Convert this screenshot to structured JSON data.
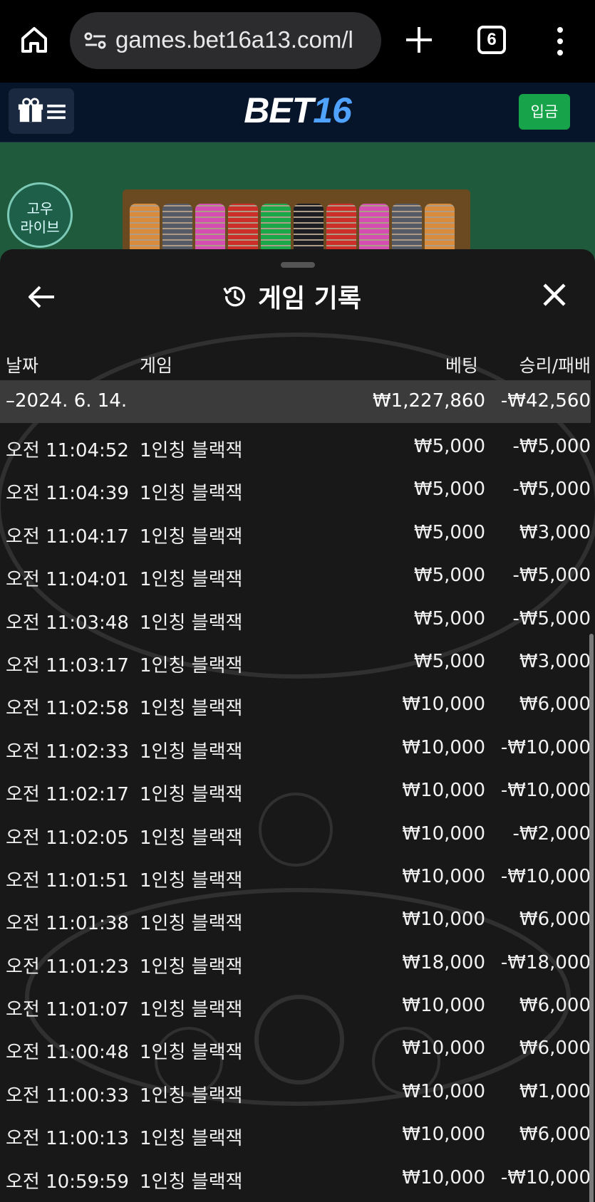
{
  "browser": {
    "url": "games.bet16a13.com/l",
    "tab_count": "6",
    "icons": [
      "home-icon",
      "site-settings-icon",
      "plus-icon",
      "tabs-icon",
      "more-vert-icon"
    ]
  },
  "header": {
    "logo_part1": "BET",
    "logo_part2": "16",
    "deposit_label": "입금",
    "colors": {
      "bg": "#07152b",
      "deposit": "#16a34a",
      "logo_accent": "#4fa3ff"
    }
  },
  "game": {
    "live_badge_line1": "고우",
    "live_badge_line2": "라이브",
    "chip_colors": [
      "#d98c3c",
      "#555b66",
      "#d44fb1",
      "#cc2f2a",
      "#1aa84a",
      "#1d1d24",
      "#cc2f2a",
      "#d44fb1",
      "#555b66",
      "#d98c3c"
    ]
  },
  "sheet": {
    "title": "게임 기록",
    "columns": {
      "date": "날짜",
      "game": "게임",
      "bet": "베팅",
      "result": "승리/패배"
    },
    "summary": {
      "date": "–2024. 6. 14.",
      "bet": "₩1,227,860",
      "result": "-₩42,560"
    },
    "rows": [
      {
        "time": "오전 11:04:52",
        "game": "1인칭 블랙잭",
        "bet": "₩5,000",
        "result": "-₩5,000"
      },
      {
        "time": "오전 11:04:39",
        "game": "1인칭 블랙잭",
        "bet": "₩5,000",
        "result": "-₩5,000"
      },
      {
        "time": "오전 11:04:17",
        "game": "1인칭 블랙잭",
        "bet": "₩5,000",
        "result": "₩3,000"
      },
      {
        "time": "오전 11:04:01",
        "game": "1인칭 블랙잭",
        "bet": "₩5,000",
        "result": "-₩5,000"
      },
      {
        "time": "오전 11:03:48",
        "game": "1인칭 블랙잭",
        "bet": "₩5,000",
        "result": "-₩5,000"
      },
      {
        "time": "오전 11:03:17",
        "game": "1인칭 블랙잭",
        "bet": "₩5,000",
        "result": "₩3,000"
      },
      {
        "time": "오전 11:02:58",
        "game": "1인칭 블랙잭",
        "bet": "₩10,000",
        "result": "₩6,000"
      },
      {
        "time": "오전 11:02:33",
        "game": "1인칭 블랙잭",
        "bet": "₩10,000",
        "result": "-₩10,000"
      },
      {
        "time": "오전 11:02:17",
        "game": "1인칭 블랙잭",
        "bet": "₩10,000",
        "result": "-₩10,000"
      },
      {
        "time": "오전 11:02:05",
        "game": "1인칭 블랙잭",
        "bet": "₩10,000",
        "result": "-₩2,000"
      },
      {
        "time": "오전 11:01:51",
        "game": "1인칭 블랙잭",
        "bet": "₩10,000",
        "result": "-₩10,000"
      },
      {
        "time": "오전 11:01:38",
        "game": "1인칭 블랙잭",
        "bet": "₩10,000",
        "result": "₩6,000"
      },
      {
        "time": "오전 11:01:23",
        "game": "1인칭 블랙잭",
        "bet": "₩18,000",
        "result": "-₩18,000"
      },
      {
        "time": "오전 11:01:07",
        "game": "1인칭 블랙잭",
        "bet": "₩10,000",
        "result": "₩6,000"
      },
      {
        "time": "오전 11:00:48",
        "game": "1인칭 블랙잭",
        "bet": "₩10,000",
        "result": "₩6,000"
      },
      {
        "time": "오전 11:00:33",
        "game": "1인칭 블랙잭",
        "bet": "₩10,000",
        "result": "₩1,000"
      },
      {
        "time": "오전 11:00:13",
        "game": "1인칭 블랙잭",
        "bet": "₩10,000",
        "result": "₩6,000"
      },
      {
        "time": "오전 10:59:59",
        "game": "1인칭 블랙잭",
        "bet": "₩10,000",
        "result": "-₩10,000"
      }
    ]
  }
}
